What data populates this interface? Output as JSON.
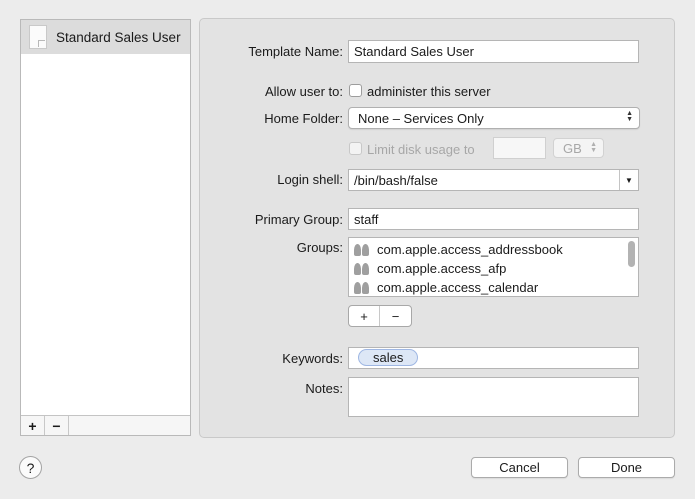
{
  "sidebar": {
    "template_item": "Standard Sales User",
    "add_symbol": "+",
    "remove_symbol": "−"
  },
  "form": {
    "template_name_label": "Template Name:",
    "template_name_value": "Standard Sales User",
    "allow_label": "Allow user to:",
    "administer_label": "administer this server",
    "home_folder_label": "Home Folder:",
    "home_folder_value": "None – Services Only",
    "limit_disk_label": "Limit disk usage to",
    "disk_unit": "GB",
    "login_shell_label": "Login shell:",
    "login_shell_value": "/bin/bash/false",
    "primary_group_label": "Primary Group:",
    "primary_group_value": "staff",
    "groups_label": "Groups:",
    "groups": [
      "com.apple.access_addressbook",
      "com.apple.access_afp",
      "com.apple.access_calendar"
    ],
    "group_add_symbol": "+",
    "group_remove_symbol": "−",
    "keywords_label": "Keywords:",
    "keyword_token": "sales",
    "notes_label": "Notes:"
  },
  "footer": {
    "help_symbol": "?",
    "cancel_label": "Cancel",
    "done_label": "Done"
  }
}
